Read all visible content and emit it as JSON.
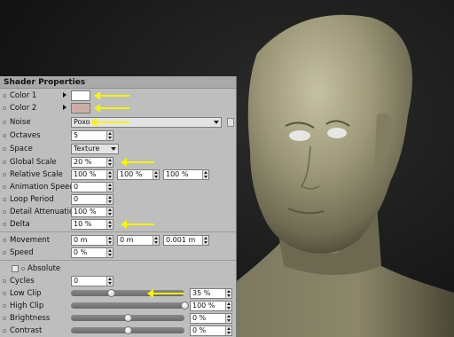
{
  "panel": {
    "title": "Shader Properties"
  },
  "colors": {
    "color1": "#ffffff",
    "color2": "#ccaca4",
    "annotation": "#f7f500"
  },
  "rows": {
    "color1": {
      "label": "Color 1"
    },
    "color2": {
      "label": "Color 2"
    },
    "noise": {
      "label": "Noise",
      "value": "Poxo"
    },
    "octaves": {
      "label": "Octaves",
      "value": "5"
    },
    "space": {
      "label": "Space",
      "value": "Texture"
    },
    "global_scale": {
      "label": "Global Scale",
      "value": "20 %"
    },
    "relative_scale": {
      "label": "Relative Scale",
      "values": [
        "100 %",
        "100 %",
        "100 %"
      ]
    },
    "animation_speed": {
      "label": "Animation Speed",
      "value": "0"
    },
    "loop_period": {
      "label": "Loop Period",
      "value": "0"
    },
    "detail_attenuation": {
      "label": "Detail Attenuation",
      "value": "100 %"
    },
    "delta": {
      "label": "Delta",
      "value": "10 %"
    },
    "movement": {
      "label": "Movement",
      "values": [
        "0 m",
        "0 m",
        "0.001 m"
      ]
    },
    "speed": {
      "label": "Speed",
      "value": "0 %"
    },
    "absolute": {
      "label": "Absolute",
      "checked": false
    },
    "cycles": {
      "label": "Cycles",
      "value": "0"
    },
    "low_clip": {
      "label": "Low Clip",
      "value": "35 %",
      "level": 0.35
    },
    "high_clip": {
      "label": "High Clip",
      "value": "100 %",
      "level": 1.0
    },
    "brightness": {
      "label": "Brightness",
      "value": "0 %",
      "level": 0.5
    },
    "contrast": {
      "label": "Contrast",
      "value": "0 %",
      "level": 0.5
    }
  },
  "icons": {
    "row_dot": "parameter-dot-icon",
    "expand": "expand-triangle-icon",
    "spinner": "spinner-arrows-icon",
    "annotation": "yellow-arrow-icon"
  }
}
